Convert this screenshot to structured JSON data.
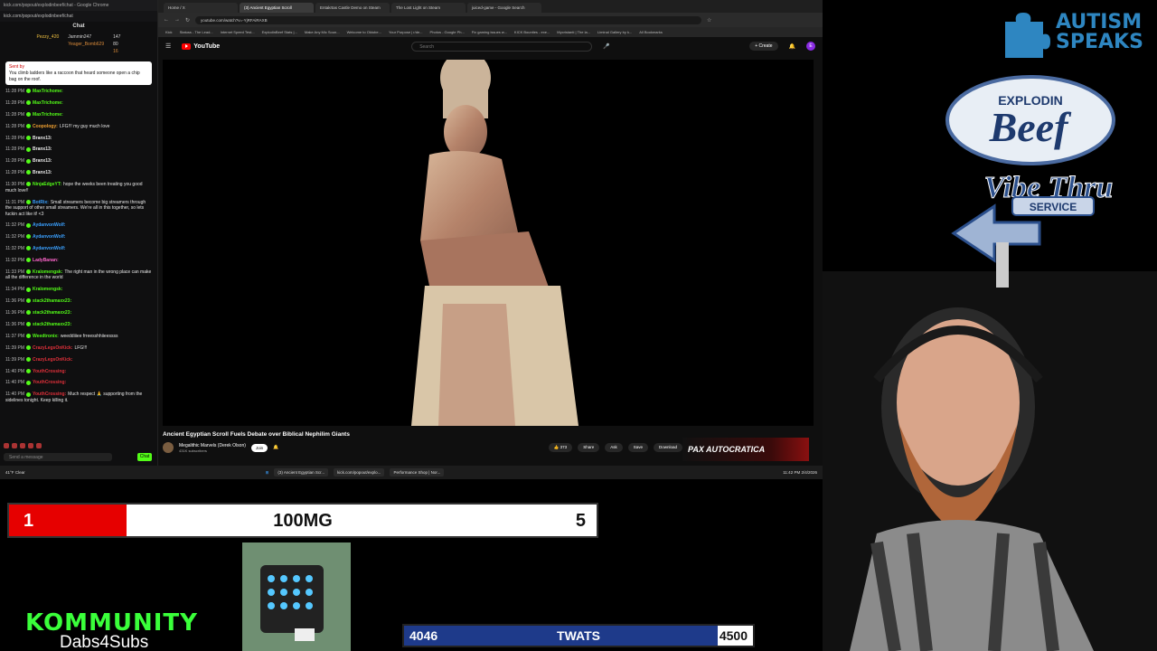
{
  "chat": {
    "window_title": "kick.com/popout/explodinbeef/chat - Google Chrome",
    "url": "kick.com/popout/explodinbeef/chat",
    "header": "Chat",
    "leaders": [
      {
        "name": "Pezzy_420",
        "count": "147"
      },
      {
        "name": "Jammin247",
        "count": "80"
      },
      {
        "name": "Yeager_Bomb629",
        "count": "16"
      }
    ],
    "pinned": {
      "sent_by": "Sent by",
      "text": "You climb ladders like a raccoon that heard someone open a chip bag on the roof."
    },
    "messages": [
      {
        "time": "11:28 PM",
        "user": "MaxTrichome:",
        "text": "",
        "color": "#53fc18"
      },
      {
        "time": "11:28 PM",
        "user": "MaxTrichome:",
        "text": "",
        "color": "#53fc18"
      },
      {
        "time": "11:28 PM",
        "user": "MaxTrichome:",
        "text": "",
        "color": "#53fc18"
      },
      {
        "time": "11:28 PM",
        "user": "Coopology:",
        "text": "LFG!!! my guy much love",
        "color": "#f0a030"
      },
      {
        "time": "11:28 PM",
        "user": "Branx13:",
        "text": "",
        "color": "#e8e8e8"
      },
      {
        "time": "11:28 PM",
        "user": "Branx13:",
        "text": "",
        "color": "#e8e8e8"
      },
      {
        "time": "11:28 PM",
        "user": "Branx13:",
        "text": "",
        "color": "#e8e8e8"
      },
      {
        "time": "11:28 PM",
        "user": "Branx13:",
        "text": "",
        "color": "#e8e8e8"
      },
      {
        "time": "11:30 PM",
        "user": "NinjaEdgeYT:",
        "text": "hope the weeks been treating you good much love!!",
        "color": "#53fc18"
      },
      {
        "time": "11:31 PM",
        "user": "BotRix:",
        "text": "Small streamers become big streamers through the support of other small streamers. We're all in this together, so lets fuckin act like it! <3",
        "color": "#3aa0ff"
      },
      {
        "time": "11:32 PM",
        "user": "AydanvonWolf:",
        "text": "",
        "color": "#3aa0ff"
      },
      {
        "time": "11:32 PM",
        "user": "AydanvonWolf:",
        "text": "",
        "color": "#3aa0ff"
      },
      {
        "time": "11:32 PM",
        "user": "AydanvonWolf:",
        "text": "",
        "color": "#3aa0ff"
      },
      {
        "time": "11:32 PM",
        "user": "LadyBanan:",
        "text": "",
        "color": "#ff66cc"
      },
      {
        "time": "11:33 PM",
        "user": "Kralomengsk:",
        "text": "The right man in the wrong place can make all the difference in the world",
        "color": "#53fc18"
      },
      {
        "time": "11:34 PM",
        "user": "Kralomengsk:",
        "text": "",
        "color": "#53fc18"
      },
      {
        "time": "11:36 PM",
        "user": "stack2thamaxx23:",
        "text": "",
        "color": "#53fc18"
      },
      {
        "time": "11:36 PM",
        "user": "stack2thamaxx23:",
        "text": "",
        "color": "#53fc18"
      },
      {
        "time": "11:36 PM",
        "user": "stack2thamaxx23:",
        "text": "",
        "color": "#53fc18"
      },
      {
        "time": "11:37 PM",
        "user": "Weedtronix:",
        "text": "weeddiiiee frreesshhiieessss",
        "color": "#53fc18"
      },
      {
        "time": "11:39 PM",
        "user": "CrazyLegsOnKick:",
        "text": "LFG!!!",
        "color": "#e0303a"
      },
      {
        "time": "11:39 PM",
        "user": "CrazyLegsOnKick:",
        "text": "",
        "color": "#e0303a"
      },
      {
        "time": "11:40 PM",
        "user": "YouthCrossing:",
        "text": "",
        "color": "#e0303a"
      },
      {
        "time": "11:40 PM",
        "user": "YouthCrossing:",
        "text": "",
        "color": "#e0303a"
      },
      {
        "time": "11:40 PM",
        "user": "YouthCrossing:",
        "text": "Much respect 🙏 supporting from the sidelines tonight. Keep killing it.",
        "color": "#e0303a"
      }
    ],
    "input_placeholder": "Send a message",
    "send_label": "Chat"
  },
  "browser": {
    "tabs": [
      "Home / X",
      "(3) Ancient Egyptian Scroll",
      "Entakrtas Castle Demo on Steam",
      "The Lost Light on Steam",
      "juiced-game - Google Search"
    ],
    "url": "youtube.com/watch?v=-YjRFAiRAXB",
    "bookmarks": [
      "Kick",
      "Statuss - The Lead...",
      "Internet Speed Test...",
      "ExplodinBeef Stats |...",
      "Make Any Mic Soun...",
      "Welcome to Oktobe...",
      "Your Purpose | r/de...",
      "Photos - Google Ph...",
      "Fix gaming issues w...",
      "KICK Bounties - exe...",
      "Mycristanti | The la...",
      "Liminal Gallery by k...",
      "All Bookmarks"
    ],
    "yt": {
      "logo": "YouTube",
      "search_placeholder": "Search",
      "create": "+ Create",
      "avatar_letter": "E",
      "video_title": "Ancient Egyptian Scroll Fuels Debate over Biblical Nephilim Giants",
      "channel": "Megalithic Marvels (Derek Olson)",
      "subs": "431K subscribers",
      "join": "Join",
      "likes": "373",
      "share": "Share",
      "ask": "Ask",
      "save": "Save",
      "download": "Download"
    },
    "banner": "PAX AUTOCRATICA"
  },
  "taskbar": {
    "weather_temp": "41°F",
    "weather_desc": "Clear",
    "items": [
      "(3) Ancient Egyptian Scr...",
      "kick.com/popout/explo...",
      "Performance Shop | Nor..."
    ],
    "clock": "11:42 PM",
    "date": "2/4/2026"
  },
  "overlays": {
    "autism_line1": "AUTISM",
    "autism_line2": "SPEAKS",
    "brand_top": "EXPLODIN",
    "brand_main": "Beef",
    "brand_sub": "Vibe Thru",
    "brand_service": "SERVICE",
    "goal1": {
      "left": "1",
      "label": "100MG",
      "right": "5",
      "progress": 0.2
    },
    "goal2": {
      "left": "4046",
      "label": "TWATS",
      "right": "4500",
      "progress": 0.8991
    },
    "kommunity": "KOMMUNITY",
    "dabs": "Dabs4Subs"
  }
}
